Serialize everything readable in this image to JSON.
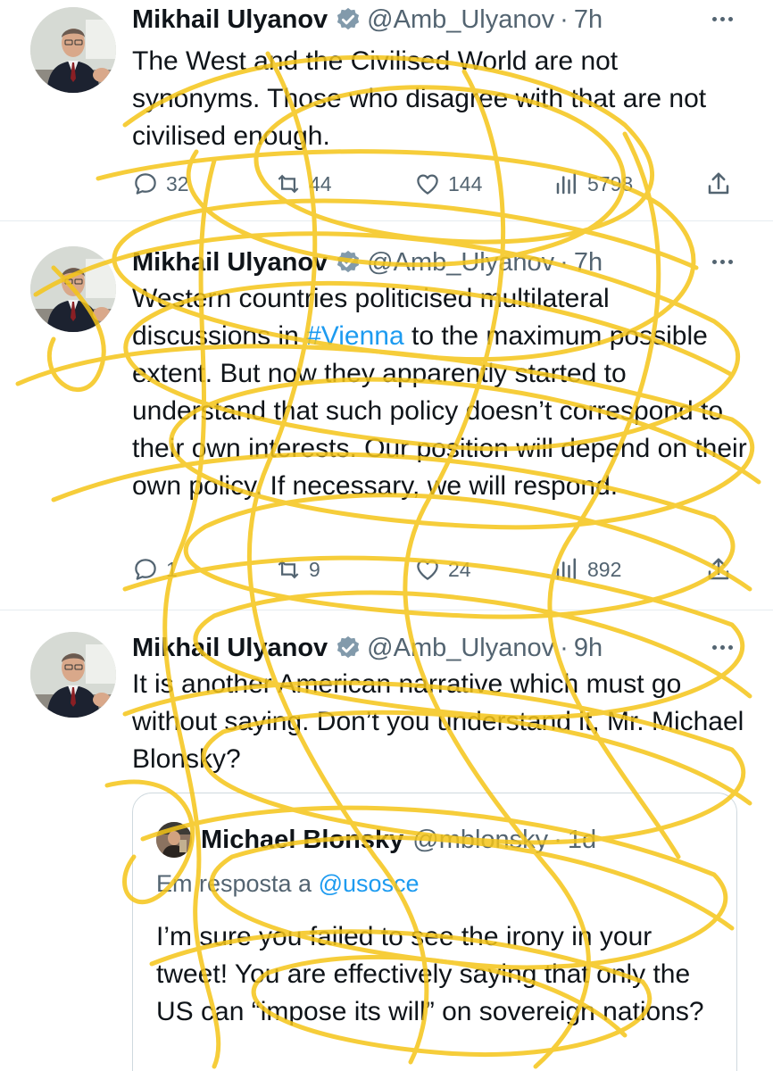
{
  "tweets": [
    {
      "name": "Mikhail Ulyanov",
      "handle": "@Amb_Ulyanov",
      "dot": "·",
      "time": "7h",
      "text_parts": [
        "The West and the Civilised World  are not synonyms. Those who disagree with that are not civilised enough."
      ],
      "replies": "32",
      "retweets": "44",
      "likes": "144",
      "views": "5798"
    },
    {
      "name": "Mikhail Ulyanov",
      "handle": "@Amb_Ulyanov",
      "dot": "·",
      "time": "7h",
      "text_before": "Western countries politicised multilateral discussions in ",
      "hashtag": "#Vienna",
      "text_after": " to the maximum possible extent. But now they apparently started to understand that such policy doesn’t correspond to their own interests. Our position will depend on their own policy. If necessary, we will respond.",
      "replies": "1",
      "retweets": "9",
      "likes": "24",
      "views": "892"
    },
    {
      "name": "Mikhail Ulyanov",
      "handle": "@Amb_Ulyanov",
      "dot": "·",
      "time": "9h",
      "text": "It is another American narrative which must go without saying. Don’t you understand it, Mr. Michael Blonsky?",
      "quote": {
        "name": "Michael Blonsky",
        "handle": "@mblonsky",
        "dot": "·",
        "time": "1d",
        "reply_prefix": "Em resposta a",
        "reply_mention": "@usosce",
        "text": "I’m sure you failed to see the irony in your tweet! You are effectively saying that only the US can “impose its will” on sovereign nations?"
      }
    }
  ],
  "icons": {
    "reply": "reply-icon",
    "retweet": "retweet-icon",
    "like": "heart-icon",
    "views": "views-icon",
    "share": "share-icon",
    "verified": "verified-badge-icon",
    "more": "more-icon"
  },
  "colors": {
    "text": "#0f1419",
    "muted": "#536471",
    "link": "#1d9bf0",
    "verified_badge": "#829aab",
    "scribble": "#f5c518"
  }
}
